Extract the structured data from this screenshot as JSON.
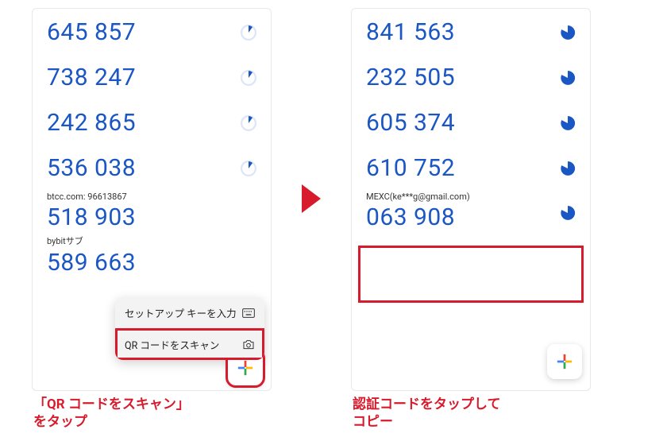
{
  "left": {
    "codes": [
      {
        "code": "645 857",
        "progress": 0.12,
        "label": null
      },
      {
        "code": "738 247",
        "progress": 0.12,
        "label": null
      },
      {
        "code": "242 865",
        "progress": 0.12,
        "label": null
      },
      {
        "code": "536 038",
        "progress": 0.12,
        "label": null
      },
      {
        "code": "518 903",
        "label": "btcc.com: 96613867"
      },
      {
        "code": "589 663",
        "label": "bybitサブ"
      }
    ],
    "popup": {
      "enter_key": "セットアップ キーを入力",
      "scan_qr": "QR コードをスキャン"
    },
    "caption_line1": "「QR コードをスキャン」",
    "caption_line2": "をタップ"
  },
  "right": {
    "codes": [
      {
        "code": "841 563",
        "progress": 0.8,
        "label": null
      },
      {
        "code": "232 505",
        "progress": 0.8,
        "label": null
      },
      {
        "code": "605 374",
        "progress": 0.8,
        "label": null
      },
      {
        "code": "610 752",
        "progress": 0.8,
        "label": null
      },
      {
        "code": "063 908",
        "progress": 0.8,
        "label": "MEXC(ke***g@gmail.com)"
      }
    ],
    "caption_line1": "認証コードをタップして",
    "caption_line2": "コピー"
  },
  "colors": {
    "accent": "#1a56c4",
    "highlight": "#d81b2c"
  }
}
